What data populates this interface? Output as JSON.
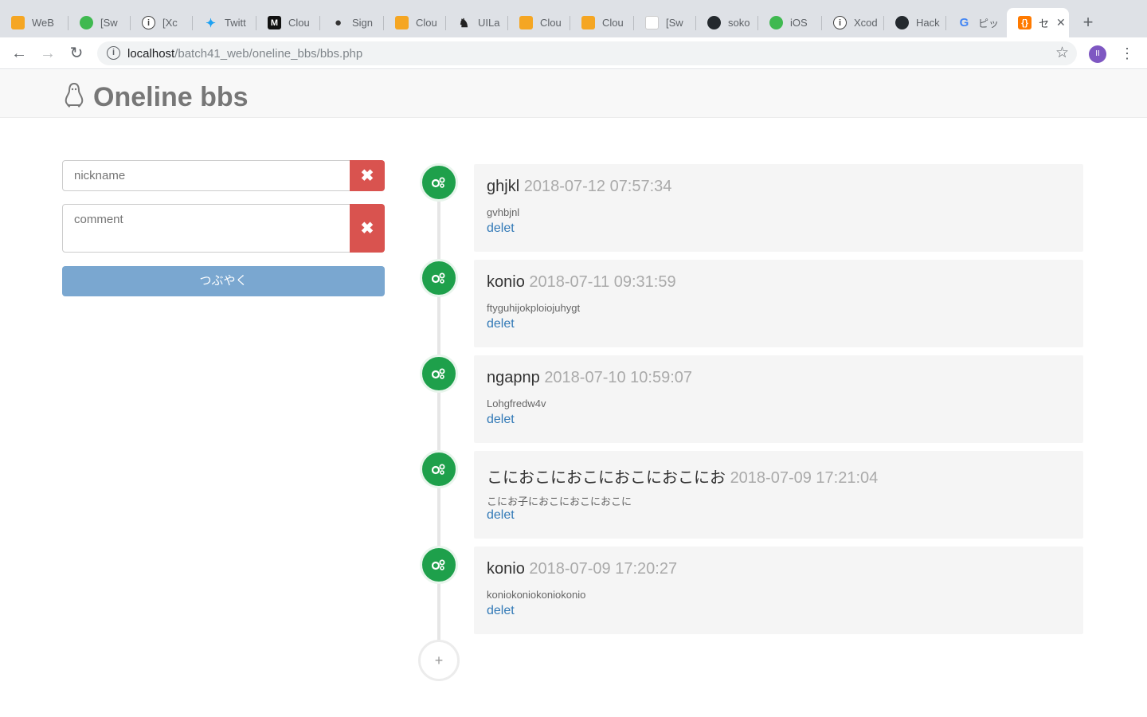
{
  "browser": {
    "tabs": [
      {
        "title": "WeB",
        "fav": "flame-icon",
        "color": "#f5a623"
      },
      {
        "title": "[Sw",
        "fav": "green-app-icon",
        "color": "#3fb950"
      },
      {
        "title": "[Xc",
        "fav": "info-icon",
        "color": "#555555"
      },
      {
        "title": "Twitt",
        "fav": "twitter-icon",
        "color": "#1da1f2"
      },
      {
        "title": "Clou",
        "fav": "m-icon",
        "color": "#111111"
      },
      {
        "title": "Sign",
        "fav": "apple-icon",
        "color": "#333333"
      },
      {
        "title": "Clou",
        "fav": "flame-icon",
        "color": "#f5a623"
      },
      {
        "title": "UILa",
        "fav": "ant-icon",
        "color": "#222222"
      },
      {
        "title": "Clou",
        "fav": "flame-icon",
        "color": "#f5a623"
      },
      {
        "title": "Clou",
        "fav": "flame-icon",
        "color": "#f5a623"
      },
      {
        "title": "[Sw",
        "fav": "page-icon",
        "color": "#cccccc"
      },
      {
        "title": "soko",
        "fav": "github-icon",
        "color": "#24292e"
      },
      {
        "title": "iOS",
        "fav": "green-app-icon",
        "color": "#3fb950"
      },
      {
        "title": "Xcod",
        "fav": "info-icon",
        "color": "#555555"
      },
      {
        "title": "Hack",
        "fav": "octocat-icon",
        "color": "#24292e"
      },
      {
        "title": "ピッ",
        "fav": "google-icon",
        "color": "#4285f4"
      },
      {
        "title": "セ",
        "fav": "code-icon",
        "color": "#ff7a00"
      }
    ],
    "url_host": "localhost",
    "url_path": "/batch41_web/oneline_bbs/bbs.php",
    "profile_initial": "II"
  },
  "app": {
    "title": "Oneline bbs"
  },
  "form": {
    "nickname_placeholder": "nickname",
    "comment_placeholder": "comment",
    "clear_symbol": "✖",
    "submit_label": "つぶやく"
  },
  "posts": [
    {
      "name": "ghjkl",
      "date": "2018-07-12 07:57:34",
      "comment": "gvhbjnl",
      "link": "delet"
    },
    {
      "name": "konio",
      "date": "2018-07-11 09:31:59",
      "comment": "ftyguhijokploiojuhygt",
      "link": "delet"
    },
    {
      "name": "ngapnp",
      "date": "2018-07-10 10:59:07",
      "comment": "Lohgfredw4v",
      "link": "delet"
    },
    {
      "name": "こにおこにおこにおこにおこにお",
      "date": "2018-07-09 17:21:04",
      "comment": "こにお子におこにおこにおこに",
      "link": "delet"
    },
    {
      "name": "konio",
      "date": "2018-07-09 17:20:27",
      "comment": "koniokoniokoniokonio",
      "link": "delet"
    }
  ],
  "timeline_more": "+"
}
